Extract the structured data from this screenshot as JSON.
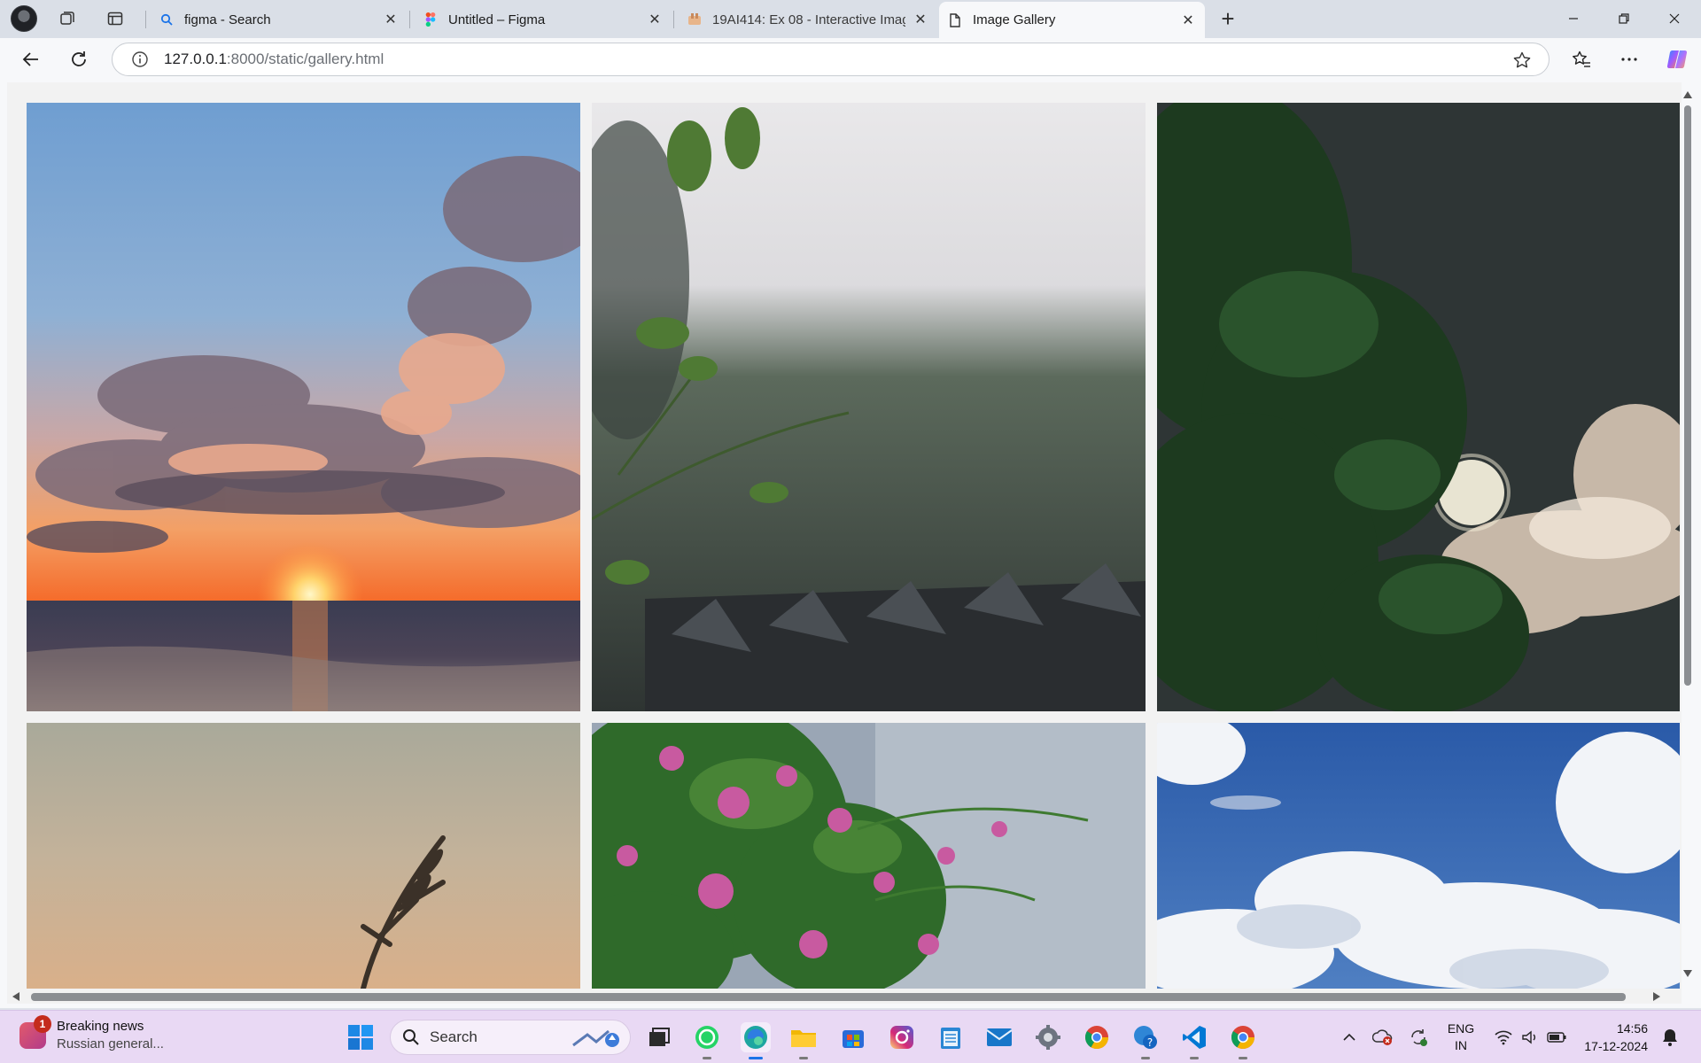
{
  "browser": {
    "tabs": [
      {
        "title": "figma - Search",
        "icon": "search-icon",
        "active": false
      },
      {
        "title": "Untitled – Figma",
        "icon": "figma-icon",
        "active": false
      },
      {
        "title": "19AI414: Ex 08 - Interactive Image",
        "icon": "page-favicon",
        "active": false
      },
      {
        "title": "Image Gallery",
        "icon": "document-icon",
        "active": true
      }
    ],
    "new_tab_label": "+",
    "url_host": "127.0.0.1",
    "url_rest": ":8000/static/gallery.html"
  },
  "gallery": {
    "photos": [
      {
        "subject": "sunset-over-sea"
      },
      {
        "subject": "rain-on-roof-with-leaves"
      },
      {
        "subject": "moon-behind-tree"
      },
      {
        "subject": "grass-at-dusk"
      },
      {
        "subject": "bougainvillea-flowers"
      },
      {
        "subject": "blue-sky-clouds"
      }
    ]
  },
  "taskbar": {
    "news_title": "Breaking news",
    "news_subtitle": "Russian general...",
    "news_badge": "1",
    "search_label": "Search",
    "lang_line1": "ENG",
    "lang_line2": "IN",
    "time": "14:56",
    "date": "17-12-2024"
  },
  "colors": {
    "tab_strip": "#dadfe7",
    "toolbar": "#f7f8fa",
    "taskbar": "#e9d9f4",
    "page_bg": "#f2f2f2"
  }
}
